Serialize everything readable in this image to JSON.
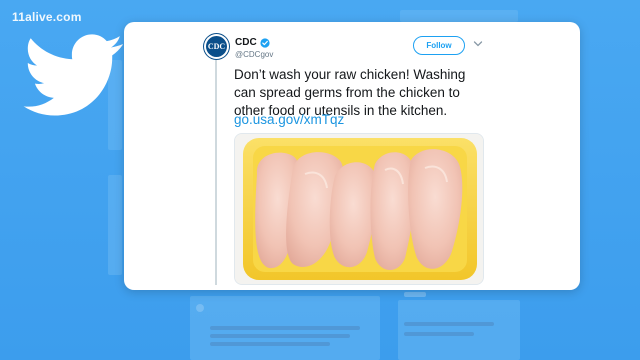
{
  "station": {
    "logo_text": "11alive.com"
  },
  "tweet": {
    "author": {
      "display_name": "CDC",
      "handle": "@CDCgov",
      "avatar_text": "CDC"
    },
    "follow_label": "Follow",
    "text": "Don’t wash your raw chicken! Washing can spread germs from the chicken to other food or utensils in the kitchen.",
    "link": "go.usa.gov/xmTqz",
    "media_description_icon": "raw-chicken-photo"
  },
  "colors": {
    "twitter_blue": "#1da1f2",
    "link_blue": "#1b95e0",
    "background_blue": "#3ea0ef",
    "tray_yellow": "#f7d23e"
  }
}
